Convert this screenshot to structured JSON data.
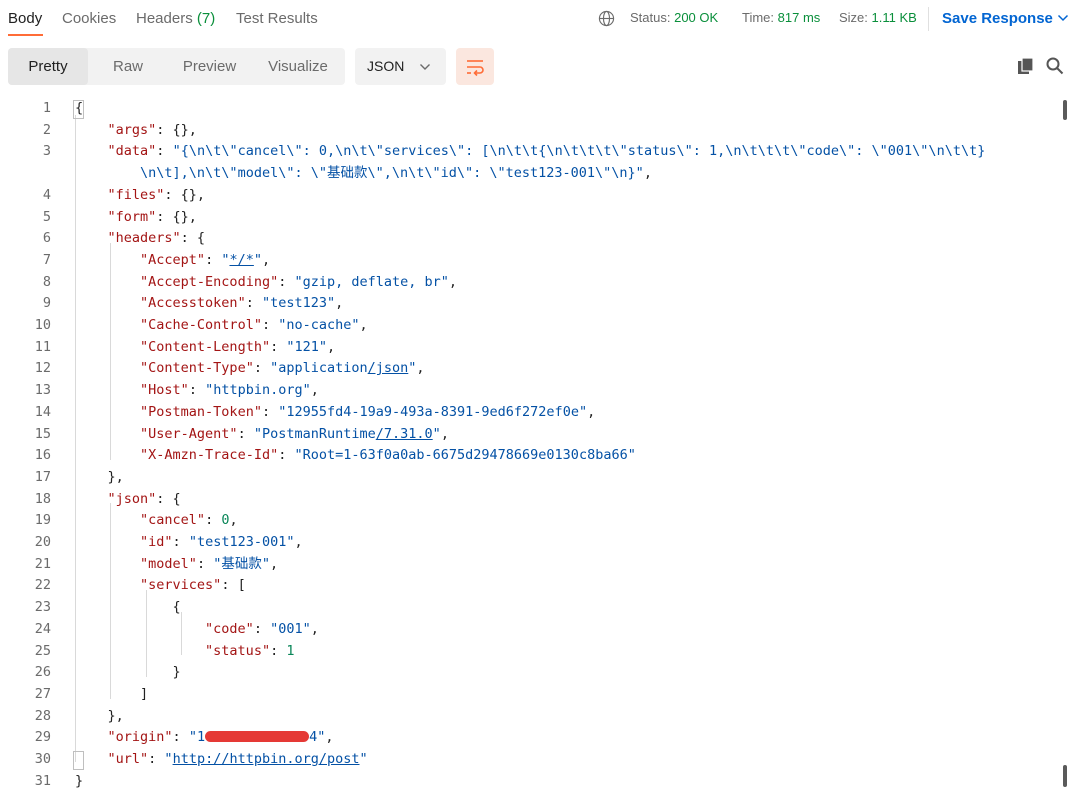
{
  "tabs": {
    "body": "Body",
    "cookies": "Cookies",
    "headers_label": "Headers",
    "headers_count": "(7)",
    "test_results": "Test Results"
  },
  "status": {
    "status_label": "Status:",
    "status_value": "200 OK",
    "time_label": "Time:",
    "time_value": "817 ms",
    "size_label": "Size:",
    "size_value": "1.11 KB",
    "save_response": "Save Response"
  },
  "view_modes": [
    "Pretty",
    "Raw",
    "Preview",
    "Visualize"
  ],
  "format": "JSON",
  "colors": {
    "accent": "#ff6c37",
    "status_ok": "#0a8f3b",
    "link": "#0265d2"
  },
  "icons": [
    "globe-icon",
    "chevron-down-icon",
    "wrap-lines-icon",
    "copy-icon",
    "search-icon"
  ],
  "code_lines": [
    {
      "n": "1",
      "html": "{"
    },
    {
      "n": "2",
      "html": "    <span class='k'>\"args\"</span>: {},"
    },
    {
      "n": "3",
      "html": "    <span class='k'>\"data\"</span>: <span class='s'>\"{\\n\\t\\\"cancel\\\": 0,\\n\\t\\\"services\\\": [\\n\\t\\t{\\n\\t\\t\\t\\\"status\\\": 1,\\n\\t\\t\\t\\\"code\\\": \\\"001\\\"\\n\\t\\t}</span>"
    },
    {
      "n": "",
      "html": "        <span class='s'>\\n\\t],\\n\\t\\\"model\\\": \\\"基础款\\\",\\n\\t\\\"id\\\": \\\"test123-001\\\"\\n}\"</span>,"
    },
    {
      "n": "4",
      "html": "    <span class='k'>\"files\"</span>: {},"
    },
    {
      "n": "5",
      "html": "    <span class='k'>\"form\"</span>: {},"
    },
    {
      "n": "6",
      "html": "    <span class='k'>\"headers\"</span>: {"
    },
    {
      "n": "7",
      "html": "        <span class='k'>\"Accept\"</span>: <span class='s'>\"<span class='lnk'>*/*</span>\"</span>,"
    },
    {
      "n": "8",
      "html": "        <span class='k'>\"Accept-Encoding\"</span>: <span class='s'>\"gzip, deflate, br\"</span>,"
    },
    {
      "n": "9",
      "html": "        <span class='k'>\"Accesstoken\"</span>: <span class='s'>\"test123\"</span>,"
    },
    {
      "n": "10",
      "html": "        <span class='k'>\"Cache-Control\"</span>: <span class='s'>\"no-cache\"</span>,"
    },
    {
      "n": "11",
      "html": "        <span class='k'>\"Content-Length\"</span>: <span class='s'>\"121\"</span>,"
    },
    {
      "n": "12",
      "html": "        <span class='k'>\"Content-Type\"</span>: <span class='s'>\"application<span class='lnk'>/json</span>\"</span>,"
    },
    {
      "n": "13",
      "html": "        <span class='k'>\"Host\"</span>: <span class='s'>\"httpbin.org\"</span>,"
    },
    {
      "n": "14",
      "html": "        <span class='k'>\"Postman-Token\"</span>: <span class='s'>\"12955fd4-19a9-493a-8391-9ed6f272ef0e\"</span>,"
    },
    {
      "n": "15",
      "html": "        <span class='k'>\"User-Agent\"</span>: <span class='s'>\"PostmanRuntime<span class='lnk'>/7.31.0</span>\"</span>,"
    },
    {
      "n": "16",
      "html": "        <span class='k'>\"X-Amzn-Trace-Id\"</span>: <span class='s'>\"Root=1-63f0a0ab-6675d29478669e0130c8ba66\"</span>"
    },
    {
      "n": "17",
      "html": "    },"
    },
    {
      "n": "18",
      "html": "    <span class='k'>\"json\"</span>: {"
    },
    {
      "n": "19",
      "html": "        <span class='k'>\"cancel\"</span>: <span class='n'>0</span>,"
    },
    {
      "n": "20",
      "html": "        <span class='k'>\"id\"</span>: <span class='s'>\"test123-001\"</span>,"
    },
    {
      "n": "21",
      "html": "        <span class='k'>\"model\"</span>: <span class='s'>\"基础款\"</span>,"
    },
    {
      "n": "22",
      "html": "        <span class='k'>\"services\"</span>: ["
    },
    {
      "n": "23",
      "html": "            {"
    },
    {
      "n": "24",
      "html": "                <span class='k'>\"code\"</span>: <span class='s'>\"001\"</span>,"
    },
    {
      "n": "25",
      "html": "                <span class='k'>\"status\"</span>: <span class='n'>1</span>"
    },
    {
      "n": "26",
      "html": "            }"
    },
    {
      "n": "27",
      "html": "        ]"
    },
    {
      "n": "28",
      "html": "    },"
    },
    {
      "n": "29",
      "html": "    <span class='k'>\"origin\"</span>: <span class='s'>\"1<span class='redact'></span>4\"</span>,"
    },
    {
      "n": "30",
      "html": "    <span class='k'>\"url\"</span>: <span class='s'>\"<span class='lnk'>http://httpbin.org/post</span>\"</span>"
    },
    {
      "n": "31",
      "html": "}"
    }
  ]
}
